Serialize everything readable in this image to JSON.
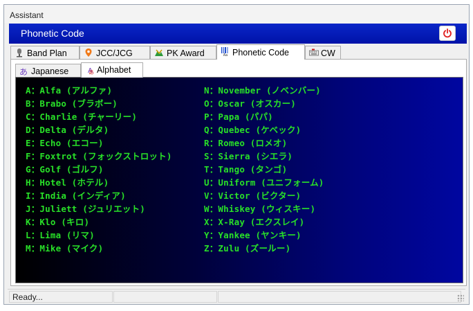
{
  "window": {
    "title": "Assistant"
  },
  "header": {
    "title": "Phonetic Code"
  },
  "main_tabs": [
    {
      "label": "Band Plan",
      "icon": "mic-icon"
    },
    {
      "label": "JCC/JCG",
      "icon": "map-pin-icon"
    },
    {
      "label": "PK Award",
      "icon": "award-icon"
    },
    {
      "label": "Phonetic Code",
      "icon": "phonetic-icon",
      "active": true
    },
    {
      "label": "CW",
      "icon": "keyboard-icon"
    }
  ],
  "sub_tabs": [
    {
      "label": "Japanese",
      "icon": "japanese-icon"
    },
    {
      "label": "Alphabet",
      "icon": "alphabet-icon",
      "active": true
    }
  ],
  "alphabet_left": [
    "A：Alfa (アルファ)",
    "B：Brabo (ブラボー)",
    "C：Charlie (チャーリー)",
    "D：Delta (デルタ)",
    "E：Echo (エコー)",
    "F：Foxtrot (フォックストロット)",
    "G：Golf (ゴルフ)",
    "H：Hotel (ホテル)",
    "I：India (インディア)",
    "J：Juliett (ジュリエット)",
    "K：Klo (キロ)",
    "L：Lima (リマ)",
    "M：Mike (マイク)"
  ],
  "alphabet_right": [
    "N：November (ノベンバー)",
    "O：Oscar (オスカー)",
    "P：Papa (パパ)",
    "Q：Quebec (ケベック)",
    "R：Romeo (ロメオ)",
    "S：Sierra (シエラ)",
    "T：Tango (タンゴ)",
    "U：Uniform (ユニフォーム)",
    "V：Victor (ビクター)",
    "W：Whiskey (ウィスキー)",
    "X：X-Ray (エクスレイ)",
    "Y：Yankee (ヤンキー)",
    "Z：Zulu (ズールー)"
  ],
  "status": {
    "text": "Ready..."
  },
  "colors": {
    "header": "#0012a8",
    "text_green": "#28e028",
    "power": "#e02020"
  }
}
